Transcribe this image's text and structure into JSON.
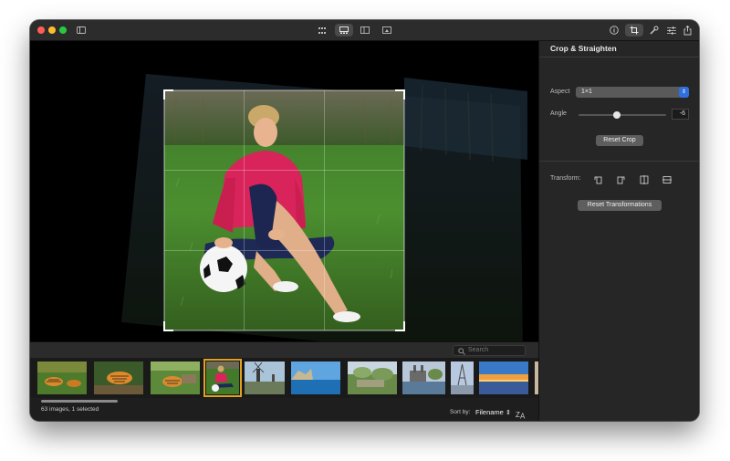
{
  "toolbar": {
    "icons": [
      "sidebar-icon",
      "grid-view-icon",
      "viewer-icon",
      "split-view-icon",
      "slideshow-icon",
      "info-icon",
      "crop-icon",
      "tools-icon",
      "adjust-icon",
      "share-icon"
    ]
  },
  "inspector": {
    "title": "Crop & Straighten",
    "aspect_label": "Aspect",
    "aspect_value": "1×1",
    "angle_label": "Angle",
    "angle_value": "-6",
    "angle_range": [
      -45,
      45
    ],
    "reset_crop_label": "Reset Crop",
    "transform_label": "Transform:",
    "transform_icons": [
      "rotate-left-icon",
      "rotate-right-icon",
      "flip-horizontal-icon",
      "flip-vertical-icon"
    ],
    "reset_transformations_label": "Reset Transformations"
  },
  "search": {
    "placeholder": "Search"
  },
  "status": {
    "text": "63 images, 1 selected"
  },
  "sort": {
    "label": "Sort by:",
    "value": "Filename",
    "order_icon": "sort-za-icon"
  },
  "colors": {
    "accent": "#2f6fe0",
    "selection": "#e0a020",
    "background": "#1e1e1e"
  }
}
